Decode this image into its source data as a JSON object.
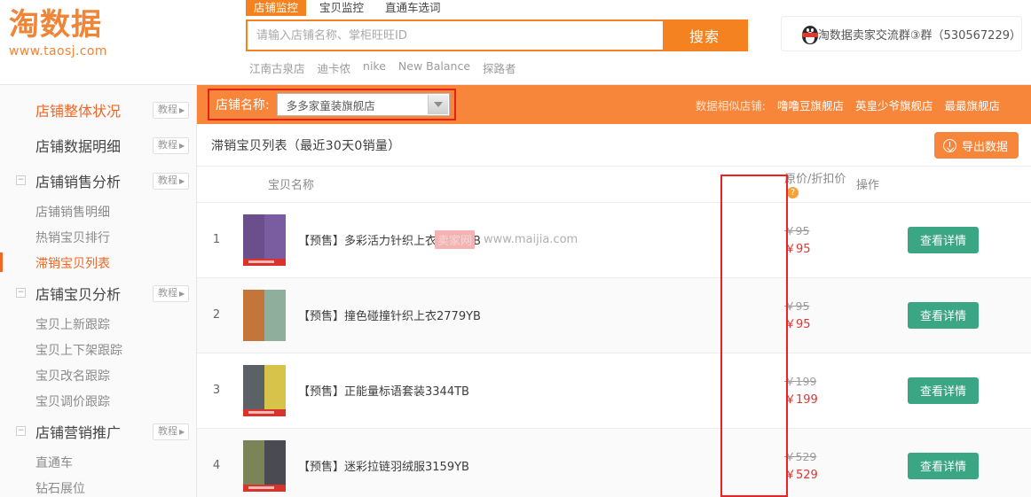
{
  "brand": {
    "logo_text": "淘数据",
    "logo_url": "www.taosj.com"
  },
  "header": {
    "tabs": [
      {
        "label": "店铺监控",
        "active": true
      },
      {
        "label": "宝贝监控",
        "active": false
      },
      {
        "label": "直通车选词",
        "active": false
      }
    ],
    "search": {
      "placeholder": "请输入店铺名称、掌柜旺旺ID",
      "value": "",
      "button_label": "搜索"
    },
    "hot_words": [
      "江南古泉店",
      "迪卡侬",
      "nike",
      "New Balance",
      "探路者"
    ],
    "qq_group": {
      "text": "淘数据卖家交流群③群（530567229）",
      "icon": "qq-penguin-icon"
    }
  },
  "sidebar": {
    "groups": [
      {
        "label": "店铺整体状况",
        "active": true,
        "collapsible": false,
        "tutorial": "教程",
        "items": []
      },
      {
        "label": "店铺数据明细",
        "active": false,
        "collapsible": false,
        "tutorial": "教程",
        "items": []
      },
      {
        "label": "店铺销售分析",
        "active": false,
        "collapsible": true,
        "toggle": "−",
        "tutorial": "教程",
        "items": [
          {
            "label": "店铺销售明细",
            "selected": false
          },
          {
            "label": "热销宝贝排行",
            "selected": false
          },
          {
            "label": "滞销宝贝列表",
            "selected": true
          }
        ]
      },
      {
        "label": "店铺宝贝分析",
        "active": false,
        "collapsible": true,
        "toggle": "−",
        "tutorial": "教程",
        "items": [
          {
            "label": "宝贝上新跟踪",
            "selected": false
          },
          {
            "label": "宝贝上下架跟踪",
            "selected": false
          },
          {
            "label": "宝贝改名跟踪",
            "selected": false
          },
          {
            "label": "宝贝调价跟踪",
            "selected": false
          }
        ]
      },
      {
        "label": "店铺营销推广",
        "active": false,
        "collapsible": true,
        "toggle": "−",
        "tutorial": "教程",
        "items": [
          {
            "label": "直通车",
            "selected": false
          },
          {
            "label": "钻石展位",
            "selected": false
          }
        ]
      }
    ]
  },
  "shop_bar": {
    "label": "店铺名称:",
    "selected_shop": "多多家童装旗舰店",
    "similar_label": "数据相似店铺:",
    "similar_shops": [
      "噜噜豆旗舰店",
      "英皇少爷旗舰店",
      "最最旗舰店"
    ]
  },
  "panel": {
    "title": "滞销宝贝列表（最近30天0销量）",
    "export_label": "导出数据",
    "export_icon": "download-icon"
  },
  "table": {
    "columns": [
      "",
      "宝贝名称",
      "原价/折扣价",
      "操作"
    ],
    "price_help_icon": "question-mark-icon",
    "action_label": "查看详情",
    "currency": "￥",
    "rows": [
      {
        "index": "1",
        "name_prefix": "【预售】",
        "name": "多彩活力针织上衣2764YB",
        "original_price": "￥95",
        "discount_price": "￥95",
        "watermark": {
          "tag": "卖家网",
          "url": "www.maijia.com"
        },
        "thumb_colors": [
          "#6b4f8c",
          "#7a5ca0"
        ]
      },
      {
        "index": "2",
        "name_prefix": "【预售】",
        "name": "撞色碰撞针织上衣2779YB",
        "original_price": "￥95",
        "discount_price": "￥95",
        "thumb_colors": [
          "#c4763a",
          "#8fae9c"
        ]
      },
      {
        "index": "3",
        "name_prefix": "【预售】",
        "name": "正能量标语套装3344TB",
        "original_price": "￥199",
        "discount_price": "￥199",
        "thumb_colors": [
          "#5c6168",
          "#d7c24a"
        ]
      },
      {
        "index": "4",
        "name_prefix": "【预售】",
        "name": "迷彩拉链羽绒服3159YB",
        "original_price": "￥529",
        "discount_price": "￥529",
        "thumb_colors": [
          "#7b8456",
          "#4a4a52"
        ]
      }
    ]
  },
  "annotations": {
    "color": "#ee2222",
    "boxes": [
      "shop-name-selector",
      "price-column"
    ]
  }
}
